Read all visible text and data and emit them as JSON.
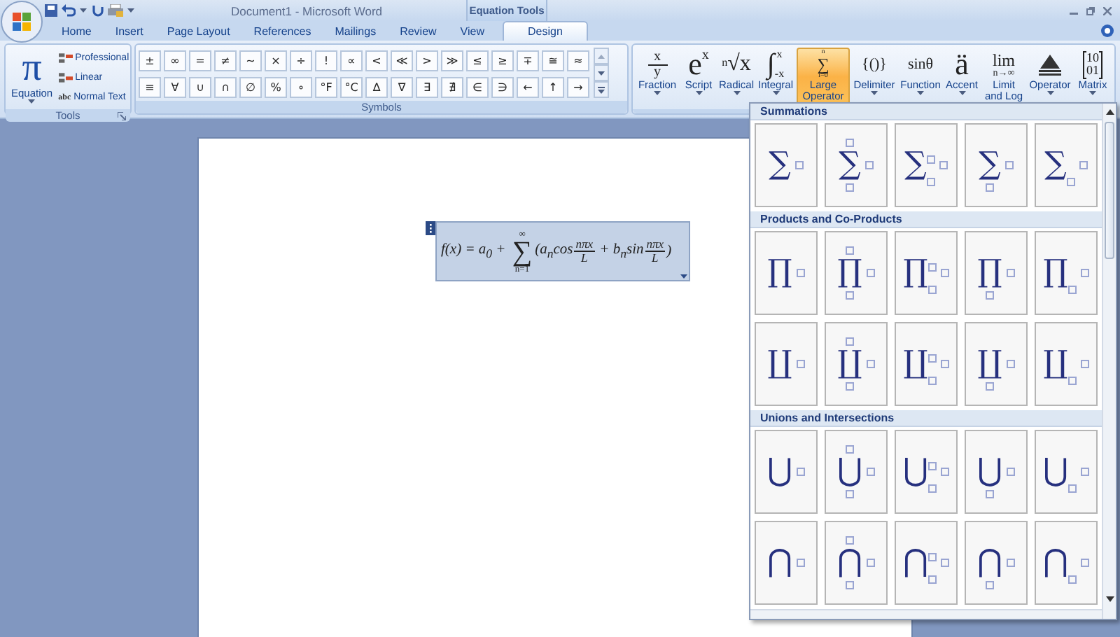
{
  "window": {
    "title": "Document1 - Microsoft Word",
    "context_tab": "Equation Tools"
  },
  "tabs": [
    {
      "label": "Home",
      "selected": false
    },
    {
      "label": "Insert",
      "selected": false
    },
    {
      "label": "Page Layout",
      "selected": false
    },
    {
      "label": "References",
      "selected": false
    },
    {
      "label": "Mailings",
      "selected": false
    },
    {
      "label": "Review",
      "selected": false
    },
    {
      "label": "View",
      "selected": false
    },
    {
      "label": "Design",
      "selected": true
    }
  ],
  "tools": {
    "label": "Tools",
    "equation": {
      "glyph": "π",
      "label": "Equation"
    },
    "options": [
      {
        "label": "Professional",
        "kind": "professional",
        "selected": false
      },
      {
        "label": "Linear",
        "kind": "linear",
        "selected": false
      },
      {
        "label": "Normal Text",
        "kind": "normal",
        "icon_text": "abc",
        "selected": false
      }
    ]
  },
  "symbols": {
    "label": "Symbols",
    "rows": [
      [
        "±",
        "∞",
        "=",
        "≠",
        "~",
        "×",
        "÷",
        "!",
        "∝",
        "<",
        "≪",
        ">",
        "≫",
        "≤",
        "≥",
        "∓",
        "≅",
        "≈"
      ],
      [
        "≡",
        "∀",
        "∪",
        "∩",
        "∅",
        "%",
        "∘",
        "°F",
        "°C",
        "∆",
        "∇",
        "∃",
        "∄",
        "∈",
        "∋",
        "←",
        "↑",
        "→"
      ]
    ]
  },
  "structures": [
    {
      "label": "Fraction",
      "kind": "fraction",
      "glyph": [
        "x",
        "y"
      ],
      "selected": false
    },
    {
      "label": "Script",
      "kind": "script",
      "glyph": [
        "e",
        "x"
      ],
      "selected": false
    },
    {
      "label": "Radical",
      "kind": "radical",
      "glyph": [
        "n",
        "√x"
      ],
      "selected": false
    },
    {
      "label": "Integral",
      "kind": "integral",
      "glyph": [
        "∫",
        "x",
        "-x"
      ],
      "selected": false
    },
    {
      "label": "Large Operator",
      "kind": "stack",
      "glyph": [
        "n",
        "∑",
        "i=0"
      ],
      "selected": true
    },
    {
      "label": "Delimiter",
      "kind": "plain",
      "glyph": [
        "{()}"
      ],
      "selected": false
    },
    {
      "label": "Function",
      "kind": "plain",
      "glyph": [
        "sinθ"
      ],
      "selected": false
    },
    {
      "label": "Accent",
      "kind": "big",
      "glyph": [
        "ä"
      ],
      "selected": false
    },
    {
      "label": "Limit and Log",
      "kind": "limit",
      "glyph": [
        "lim",
        "n→∞"
      ],
      "selected": false
    },
    {
      "label": "Operator",
      "kind": "operator",
      "selected": false
    },
    {
      "label": "Matrix",
      "kind": "matrix",
      "glyph": [
        "10",
        "01"
      ],
      "selected": false
    }
  ],
  "equation": [
    {
      "kind": "text",
      "text": "f(x) = a$_{0}$ + "
    },
    {
      "kind": "op",
      "symbol": "∑",
      "upper": "∞",
      "lower": "n=1"
    },
    {
      "kind": "text",
      "text": "(a$_{n}$cos"
    },
    {
      "kind": "frac",
      "num": "nπx",
      "den": "L"
    },
    {
      "kind": "text",
      "text": " + b$_{n}$sin"
    },
    {
      "kind": "frac",
      "num": "nπx",
      "den": "L"
    },
    {
      "kind": "text",
      "text": ")"
    }
  ],
  "gallery": {
    "sections": [
      {
        "title": "Summations",
        "tiles": [
          {
            "symbol": "∑",
            "kind": "plain"
          },
          {
            "symbol": "∑",
            "kind": "limits"
          },
          {
            "symbol": "∑",
            "kind": "subsup"
          },
          {
            "symbol": "∑",
            "kind": "lower"
          },
          {
            "symbol": "∑",
            "kind": "sub"
          }
        ]
      },
      {
        "title": "Products and Co-Products",
        "tiles": [
          {
            "symbol": "∏",
            "kind": "plain"
          },
          {
            "symbol": "∏",
            "kind": "limits"
          },
          {
            "symbol": "∏",
            "kind": "subsup"
          },
          {
            "symbol": "∏",
            "kind": "lower"
          },
          {
            "symbol": "∏",
            "kind": "sub"
          },
          {
            "symbol": "∐",
            "kind": "plain"
          },
          {
            "symbol": "∐",
            "kind": "limits"
          },
          {
            "symbol": "∐",
            "kind": "subsup"
          },
          {
            "symbol": "∐",
            "kind": "lower"
          },
          {
            "symbol": "∐",
            "kind": "sub"
          }
        ]
      },
      {
        "title": "Unions and Intersections",
        "tiles": [
          {
            "symbol": "⋃",
            "kind": "plain"
          },
          {
            "symbol": "⋃",
            "kind": "limits"
          },
          {
            "symbol": "⋃",
            "kind": "subsup"
          },
          {
            "symbol": "⋃",
            "kind": "lower"
          },
          {
            "symbol": "⋃",
            "kind": "sub"
          },
          {
            "symbol": "⋂",
            "kind": "plain"
          },
          {
            "symbol": "⋂",
            "kind": "limits"
          },
          {
            "symbol": "⋂",
            "kind": "subsup"
          },
          {
            "symbol": "⋂",
            "kind": "lower"
          },
          {
            "symbol": "⋂",
            "kind": "sub"
          }
        ]
      }
    ]
  }
}
